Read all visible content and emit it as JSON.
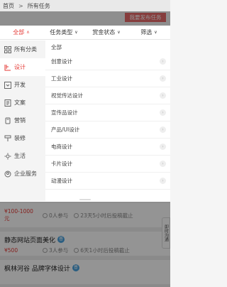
{
  "breadcrumb": {
    "home": "首页",
    "separator": ">",
    "current": "所有任务"
  },
  "publish_button": "我要发布任务",
  "filters": [
    {
      "label": "全部",
      "active": true
    },
    {
      "label": "任务类型",
      "active": false
    },
    {
      "label": "赏金状态",
      "active": false
    },
    {
      "label": "筛选",
      "active": false
    }
  ],
  "categories": [
    {
      "label": "所有分类",
      "icon": "grid-icon"
    },
    {
      "label": "设计",
      "icon": "design-icon",
      "active": true
    },
    {
      "label": "开发",
      "icon": "code-icon"
    },
    {
      "label": "文案",
      "icon": "doc-icon"
    },
    {
      "label": "营销",
      "icon": "marketing-icon"
    },
    {
      "label": "装修",
      "icon": "paint-icon"
    },
    {
      "label": "生活",
      "icon": "life-icon"
    },
    {
      "label": "企业服务",
      "icon": "business-icon"
    }
  ],
  "subcategories": {
    "all": "全部",
    "items": [
      "创意设计",
      "工业设计",
      "视觉传达设计",
      "宣传品设计",
      "产品/UI设计",
      "电商设计",
      "卡片设计",
      "动漫设计"
    ]
  },
  "tasks": [
    {
      "title": "",
      "price": "¥100-1000元",
      "participants": "0人参与",
      "deadline": "23天5小时后投稿截止"
    },
    {
      "title": "静态网站页面美化",
      "badge": "普",
      "price": "¥500",
      "participants": "3人参与",
      "deadline": "6天1小时后投稿截止"
    },
    {
      "title": "枫林河谷 品牌字体设计",
      "badge": "普",
      "price": "",
      "participants": "",
      "deadline": ""
    }
  ],
  "side_tab": "即时沟通",
  "colors": {
    "accent": "#e53935",
    "badge": "#4aa3df"
  }
}
